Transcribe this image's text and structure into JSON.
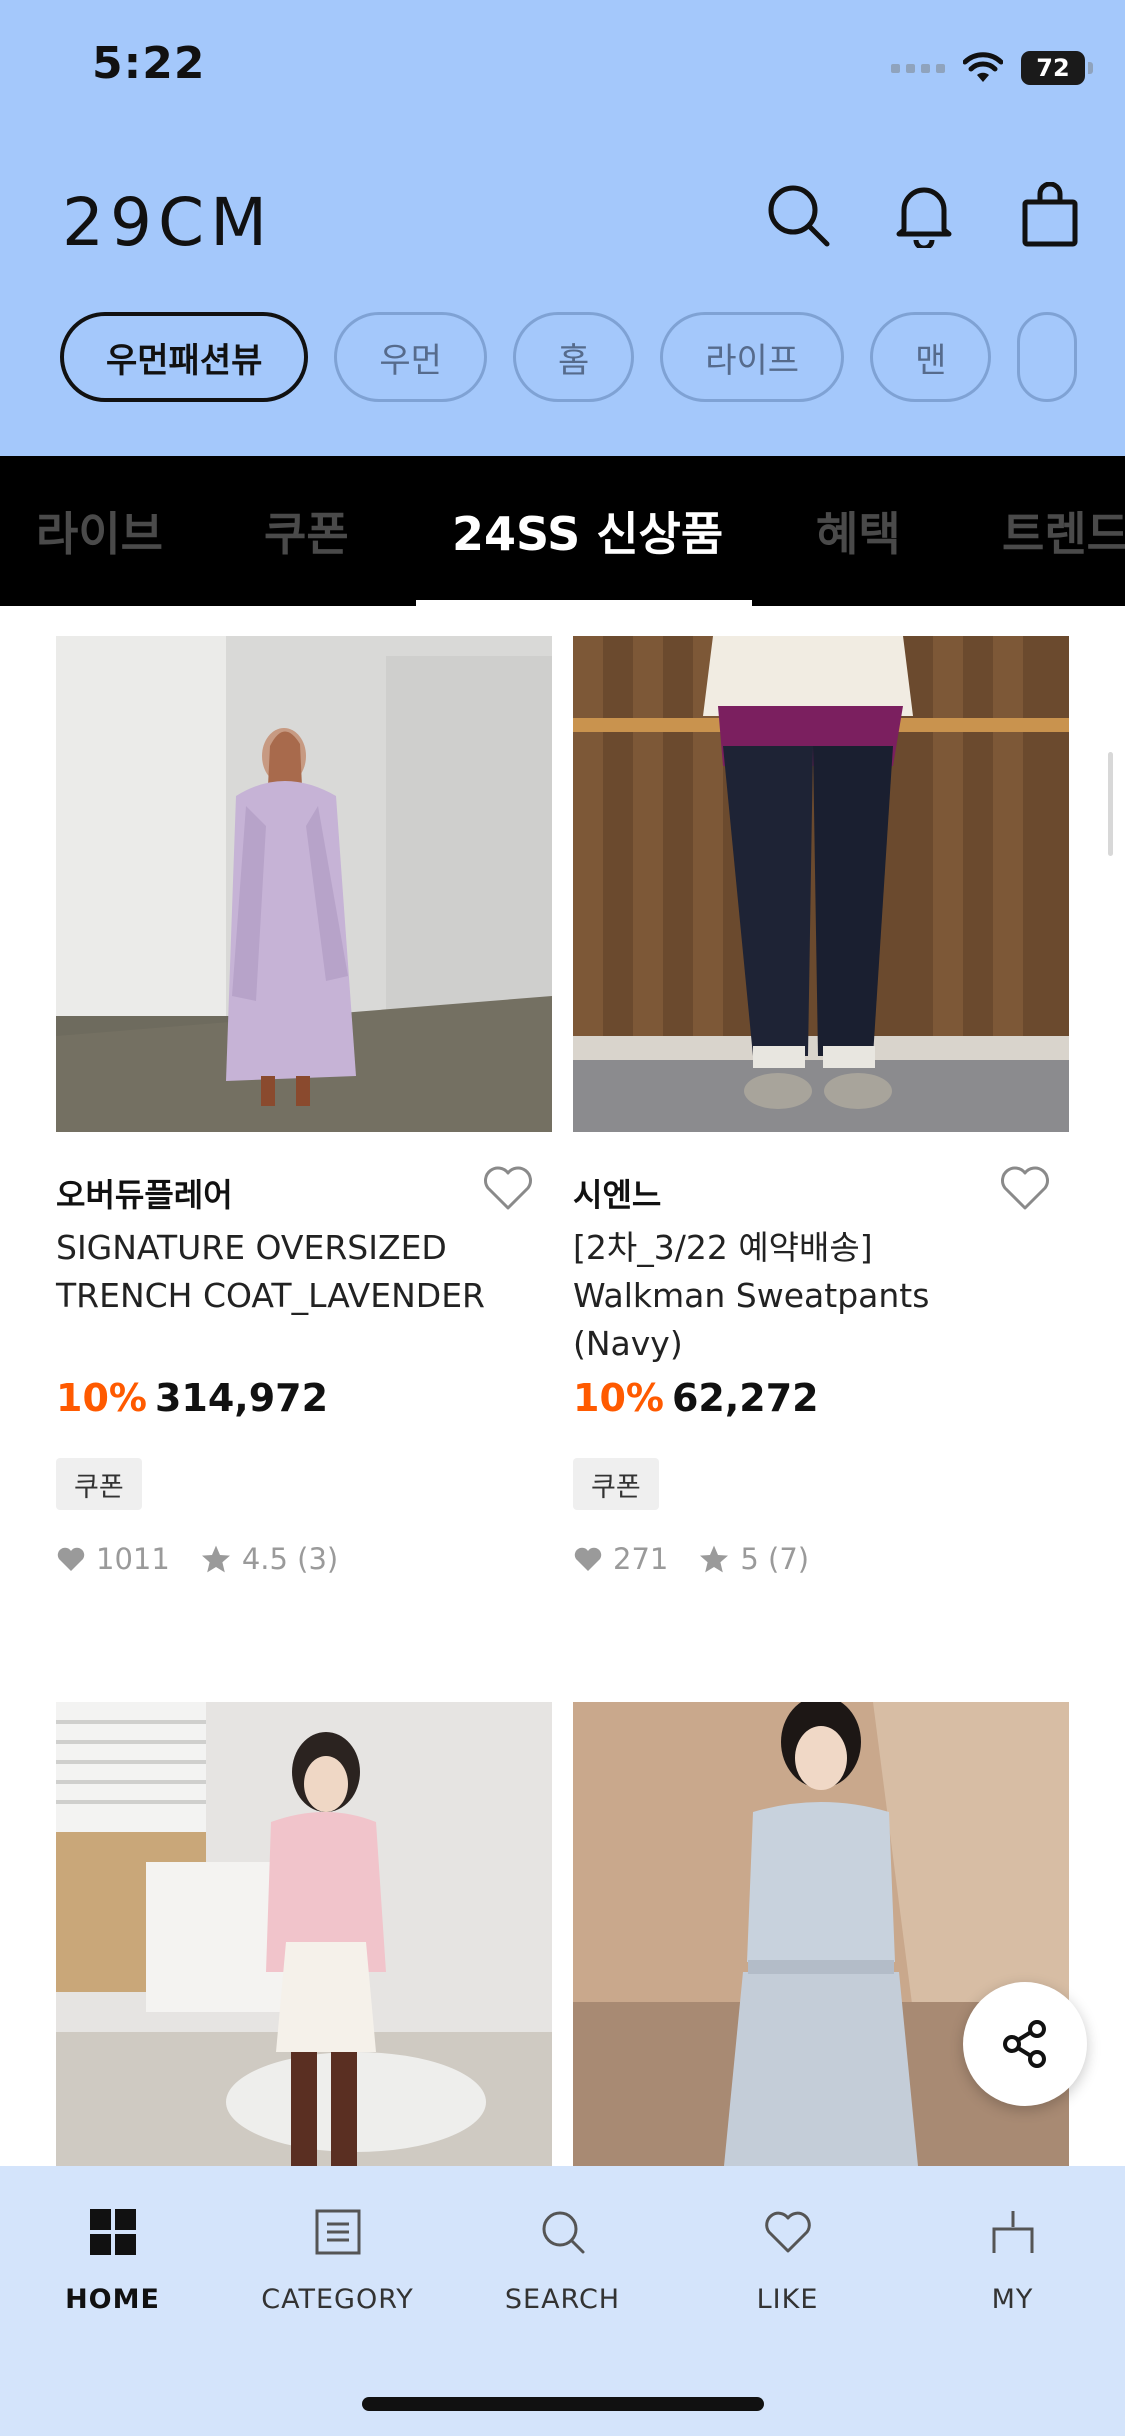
{
  "status_bar": {
    "time": "5:22",
    "battery": "72"
  },
  "header": {
    "logo": "29CM",
    "icons": [
      "search-icon",
      "bell-icon",
      "shopping-bag-icon"
    ]
  },
  "category_chips": [
    {
      "label": "우먼패션뷰",
      "active": true
    },
    {
      "label": "우먼"
    },
    {
      "label": "홈"
    },
    {
      "label": "라이프"
    },
    {
      "label": "맨"
    }
  ],
  "tabs": [
    {
      "label": "라이브"
    },
    {
      "label": "쿠폰"
    },
    {
      "label": "24SS 신상품",
      "active": true
    },
    {
      "label": "혜택"
    },
    {
      "label": "트렌드"
    }
  ],
  "products": [
    {
      "brand": "오버듀플레어",
      "name": "SIGNATURE OVERSIZED TRENCH COAT_LAVENDER",
      "discount": "10%",
      "price": "314,972",
      "coupon": "쿠폰",
      "likes": "1011",
      "rating": "4.5 (3)"
    },
    {
      "brand": "시엔느",
      "name": "[2차_3/22 예약배송] Walkman Sweatpants (Navy)",
      "discount": "10%",
      "price": "62,272",
      "coupon": "쿠폰",
      "likes": "271",
      "rating": "5 (7)"
    }
  ],
  "bottom_nav": [
    {
      "label": "HOME",
      "icon": "home-grid-icon",
      "active": true
    },
    {
      "label": "CATEGORY",
      "icon": "category-list-icon"
    },
    {
      "label": "SEARCH",
      "icon": "search-icon"
    },
    {
      "label": "LIKE",
      "icon": "heart-icon"
    },
    {
      "label": "MY",
      "icon": "person-icon"
    }
  ],
  "colors": {
    "header_bg": "#a4c8fb",
    "discount": "#ff5a00",
    "nav_bg": "#d4e4fb",
    "tabbar_bg": "#000000"
  }
}
